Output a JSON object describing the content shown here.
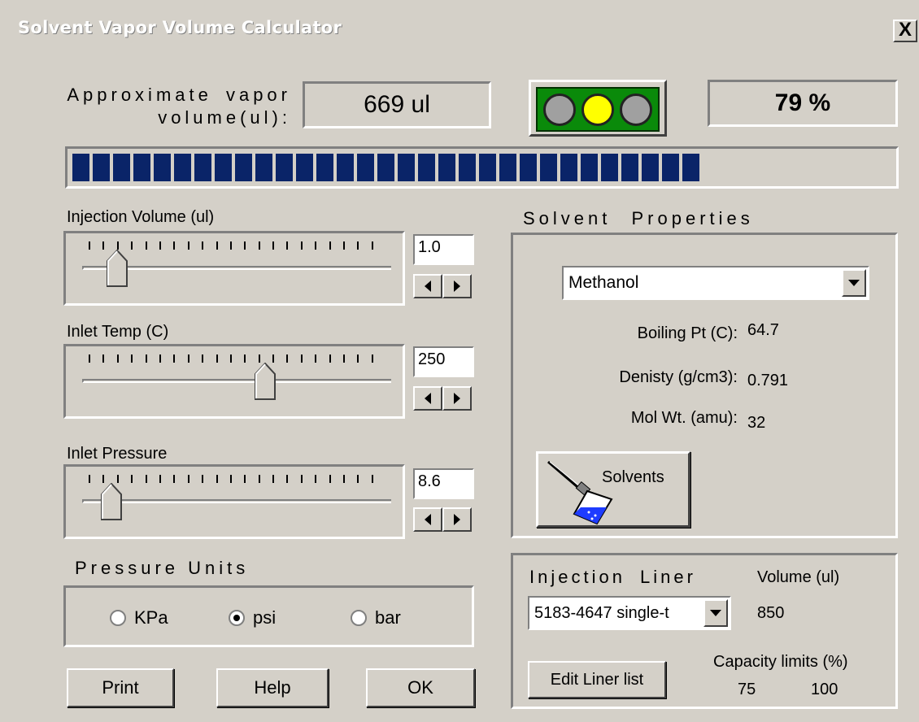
{
  "window": {
    "title": "Solvent Vapor Volume Calculator",
    "close_label": "X"
  },
  "readout": {
    "label": "Approximate vapor volume(ul):",
    "vapor_volume": "669 ul",
    "percent": "79 %",
    "percent_value": 79,
    "traffic_light": {
      "left": "off",
      "middle": "on-yellow",
      "right": "off"
    },
    "colors": {
      "lamp_on": "#ffff00",
      "lamp_off": "#a0a0a0",
      "light_panel": "#0a8a0a",
      "bar": "#0a2468"
    }
  },
  "injection_volume": {
    "label": "Injection Volume (ul)",
    "value": "1.0",
    "slider_fraction": 0.1
  },
  "inlet_temp": {
    "label": "Inlet Temp (C)",
    "value": "250",
    "slider_fraction": 0.62
  },
  "inlet_pressure": {
    "label": "Inlet Pressure",
    "value": "8.6",
    "slider_fraction": 0.08
  },
  "pressure_units": {
    "label": "Pressure Units",
    "options": [
      "KPa",
      "psi",
      "bar"
    ],
    "selected": "psi"
  },
  "buttons": {
    "print": "Print",
    "help": "Help",
    "ok": "OK"
  },
  "solvent": {
    "section_label": "Solvent Properties",
    "selected": "Methanol",
    "boiling_label": "Boiling Pt (C):",
    "boiling_value": "64.7",
    "density_label": "Denisty (g/cm3):",
    "density_value": "0.791",
    "molwt_label": "Mol Wt. (amu):",
    "molwt_value": "32",
    "solvents_button": "Solvents"
  },
  "liner": {
    "label": "Injection Liner",
    "selected": "5183-4647 single-t",
    "volume_label": "Volume (ul)",
    "volume_value": "850",
    "edit_button": "Edit Liner list",
    "capacity_label": "Capacity limits (%)",
    "capacity_low": "75",
    "capacity_high": "100"
  }
}
